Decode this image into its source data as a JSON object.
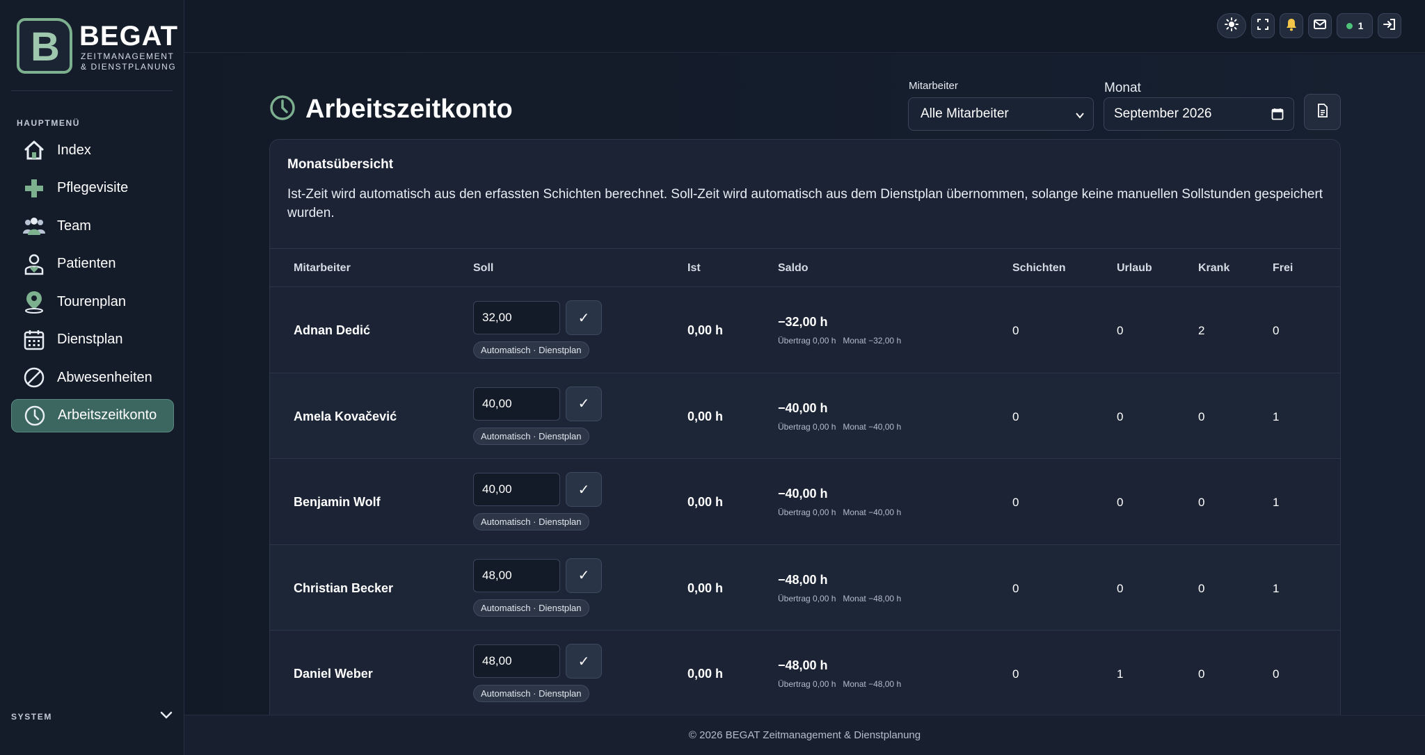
{
  "brand": {
    "letter": "B",
    "name": "BEGAT",
    "sub_line1": "ZEITMANAGEMENT",
    "sub_line2": "& DIENSTPLANUNG"
  },
  "sidebar": {
    "menu_title": "HAUPTMENÜ",
    "items": [
      {
        "label": "Index",
        "icon": "home-icon"
      },
      {
        "label": "Pflegevisite",
        "icon": "plus-icon"
      },
      {
        "label": "Team",
        "icon": "team-icon"
      },
      {
        "label": "Patienten",
        "icon": "patient-icon"
      },
      {
        "label": "Tourenplan",
        "icon": "map-pin-icon"
      },
      {
        "label": "Dienstplan",
        "icon": "calendar-icon"
      },
      {
        "label": "Abwesenheiten",
        "icon": "absence-icon"
      },
      {
        "label": "Arbeitszeitkonto",
        "icon": "clock-icon",
        "active": true
      }
    ],
    "system_label": "SYSTEM"
  },
  "topbar": {
    "message_count": "1",
    "icons": [
      "sun-icon",
      "fullscreen-icon",
      "bell-icon",
      "mail-icon",
      "status-icon",
      "logout-icon"
    ]
  },
  "page": {
    "title": "Arbeitszeitkonto",
    "filter_employee_label": "Mitarbeiter",
    "filter_employee_value": "Alle Mitarbeiter",
    "filter_month_label": "Monat",
    "filter_month_value": "September 2026"
  },
  "card": {
    "title": "Monatsübersicht",
    "description": "Ist-Zeit wird automatisch aus den erfassten Schichten berechnet. Soll-Zeit wird automatisch aus dem Dienstplan übernommen, solange keine manuellen Sollstunden gespeichert wurden."
  },
  "table": {
    "headers": {
      "mitarbeiter": "Mitarbeiter",
      "soll": "Soll",
      "ist": "Ist",
      "saldo": "Saldo",
      "schichten": "Schichten",
      "urlaub": "Urlaub",
      "krank": "Krank",
      "frei": "Frei"
    },
    "rows": [
      {
        "name": "Adnan Dedić",
        "soll": "32,00",
        "check": "✓",
        "badge": "Automatisch · Dienstplan",
        "ist": "0,00 h",
        "saldo": "−32,00 h",
        "saldo_sub": "Übertrag 0,00 h   Monat −32,00 h",
        "schichten": "0",
        "urlaub": "0",
        "krank": "2",
        "frei": "0"
      },
      {
        "name": "Amela Kovačević",
        "soll": "40,00",
        "check": "✓",
        "badge": "Automatisch · Dienstplan",
        "ist": "0,00 h",
        "saldo": "−40,00 h",
        "saldo_sub": "Übertrag 0,00 h   Monat −40,00 h",
        "schichten": "0",
        "urlaub": "0",
        "krank": "0",
        "frei": "1"
      },
      {
        "name": "Benjamin Wolf",
        "soll": "40,00",
        "check": "✓",
        "badge": "Automatisch · Dienstplan",
        "ist": "0,00 h",
        "saldo": "−40,00 h",
        "saldo_sub": "Übertrag 0,00 h   Monat −40,00 h",
        "schichten": "0",
        "urlaub": "0",
        "krank": "0",
        "frei": "1"
      },
      {
        "name": "Christian Becker",
        "soll": "48,00",
        "check": "✓",
        "badge": "Automatisch · Dienstplan",
        "ist": "0,00 h",
        "saldo": "−48,00 h",
        "saldo_sub": "Übertrag 0,00 h   Monat −48,00 h",
        "schichten": "0",
        "urlaub": "0",
        "krank": "0",
        "frei": "1"
      },
      {
        "name": "Daniel Weber",
        "soll": "48,00",
        "check": "✓",
        "badge": "Automatisch · Dienstplan",
        "ist": "0,00 h",
        "saldo": "−48,00 h",
        "saldo_sub": "Übertrag 0,00 h   Monat −48,00 h",
        "schichten": "0",
        "urlaub": "1",
        "krank": "0",
        "frei": "0"
      }
    ]
  },
  "footer": {
    "text": "© 2026 BEGAT Zeitmanagement & Dienstplanung"
  },
  "colors": {
    "accent": "#7db08f",
    "active_nav": "#3c6660",
    "background": "#131a27",
    "card": "#1b2334"
  }
}
